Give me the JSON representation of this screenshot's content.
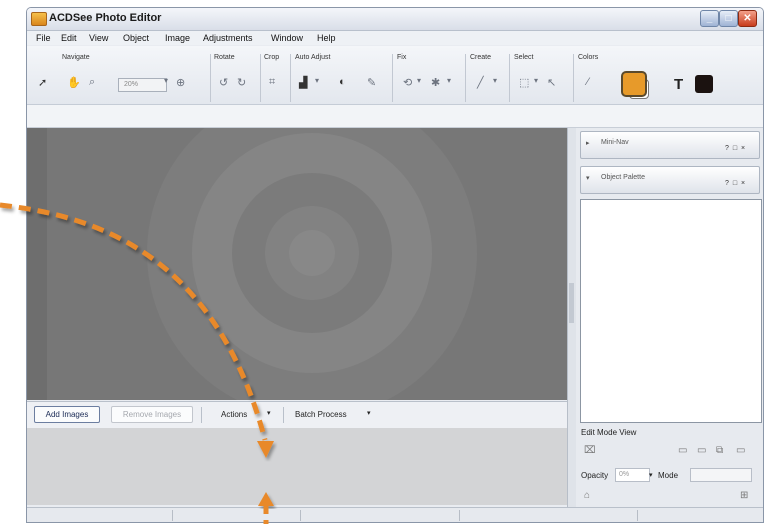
{
  "window": {
    "title": "ACDSee Photo Editor",
    "controls": [
      "_",
      "□",
      "✕"
    ]
  },
  "menu": [
    "File",
    "Edit",
    "View",
    "Object",
    "Image",
    "Adjustments",
    "Window",
    "Help"
  ],
  "toolbar": {
    "groups": [
      "Navigate",
      "Rotate",
      "Crop",
      "Auto Adjust",
      "Fix",
      "Create",
      "Select",
      "Colors"
    ],
    "zoom": "20%",
    "text_tool": "T"
  },
  "panels": {
    "mini_title": "Mini-Nav",
    "palette_title": "Object Palette",
    "controls": "? □ ×"
  },
  "edit_mode": {
    "label": "Edit Mode View",
    "opacity_label": "Opacity",
    "opacity_value": "0%",
    "mode_label": "Mode"
  },
  "batch": {
    "add": "Add Images",
    "remove": "Remove Images",
    "actions": "Actions",
    "batch_process": "Batch Process"
  },
  "colors": {
    "accent_orange": "#e8892a",
    "canvas_gray": "#777777"
  }
}
